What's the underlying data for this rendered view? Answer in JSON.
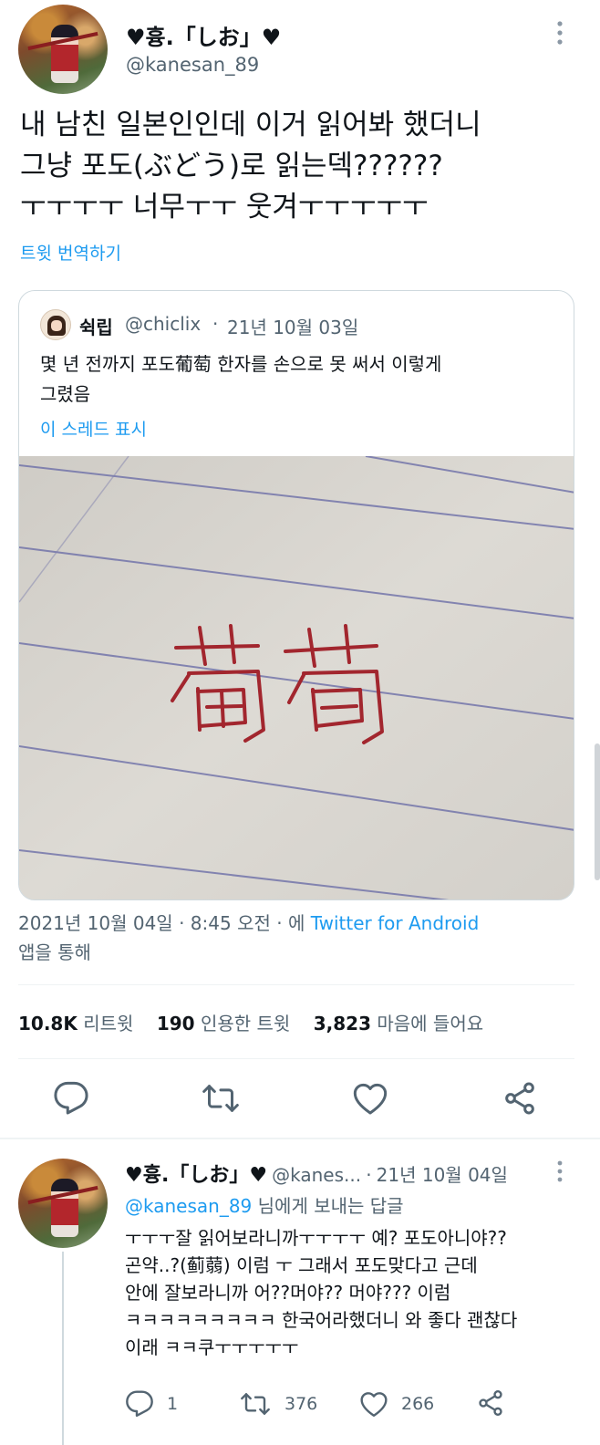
{
  "tweet": {
    "author_name": "♥흉.「しお」♥",
    "author_handle": "@kanesan_89",
    "more_icon": "more-vertical-icon",
    "text_lines": [
      "내 남친 일본인인데 이거 읽어봐 했더니",
      "그냥 포도(ぶどう)로 읽는덱??????",
      "ㅜㅜㅜㅜ 너무ㅜㅜ 웃겨ㅜㅜㅜㅜㅜ"
    ],
    "translate_label": "트윗 번역하기",
    "quote": {
      "author_name": "쉭립",
      "author_handle": "@chiclix",
      "separator": "·",
      "date": "21년 10월 03일",
      "text_lines": [
        "몇 년 전까지 포도葡萄 한자를 손으로 못 써서 이렇게",
        "그렸음"
      ],
      "show_thread_label": "이 스레드 표시",
      "image_text": "葡萄"
    },
    "meta": {
      "date": "2021년 10월 04일",
      "sep1": "·",
      "time": "8:45 오전",
      "sep2": "·",
      "via_prefix": "에",
      "source": "Twitter for Android",
      "via_suffix": "앱을 통해"
    },
    "stats": {
      "retweets": "10.8K",
      "retweets_label": "리트윗",
      "quotes": "190",
      "quotes_label": "인용한 트윗",
      "likes": "3,823",
      "likes_label": "마음에 들어요"
    },
    "actions": [
      "reply-icon",
      "retweet-icon",
      "like-icon",
      "share-icon"
    ]
  },
  "reply": {
    "author_name": "♥흉.「しお」♥",
    "author_handle": "@kanes...",
    "separator": "·",
    "date": "21년 10월 04일",
    "reply_to_handle": "@kanesan_89",
    "reply_to_suffix": "님에게 보내는 답글",
    "text_lines": [
      "ㅜㅜㅜ잘 읽어보라니까ㅜㅜㅜㅜ 예? 포도아니야??",
      "곤약..?(蓟蒻) 이럼 ㅜ 그래서 포도맞다고 근데",
      "안에 잘보라니까 어??머야?? 머야??? 이럼",
      "ㅋㅋㅋㅋㅋㅋㅋㅋㅋ 한국어라했더니 와 좋다 괜찮다",
      "이래 ㅋㅋ쿠ㅜㅜㅜㅜㅜ"
    ],
    "counts": {
      "replies": "1",
      "retweets": "376",
      "likes": "266"
    }
  },
  "colors": {
    "accent": "#1d9bf0",
    "text": "#0f1419",
    "secondary": "#536471",
    "border": "#cfd9de",
    "ink": "#a2262e",
    "paper_line": "#6d6fa8"
  }
}
